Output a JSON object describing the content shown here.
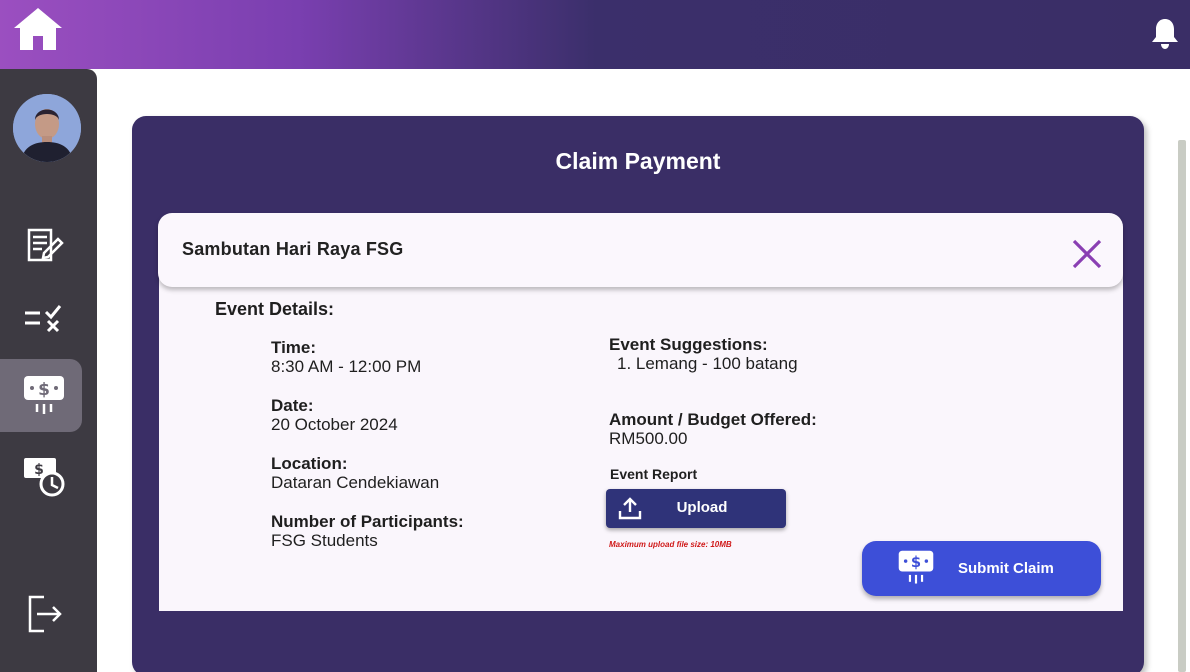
{
  "header": {
    "home_icon": "home-icon",
    "notification_icon": "bell-icon"
  },
  "sidebar": {
    "avatar": "user-avatar",
    "items": [
      {
        "icon": "document-edit-icon",
        "active": false
      },
      {
        "icon": "checklist-icon",
        "active": false
      },
      {
        "icon": "claim-payment-icon",
        "active": true
      },
      {
        "icon": "payment-history-icon",
        "active": false
      },
      {
        "icon": "logout-icon",
        "active": false
      }
    ]
  },
  "panel": {
    "title": "Claim Payment"
  },
  "card": {
    "title": "Sambutan Hari Raya FSG",
    "section_title": "Event Details:",
    "time_label": "Time:",
    "time_value": "8:30 AM - 12:00 PM",
    "date_label": "Date:",
    "date_value": "20 October 2024",
    "location_label": "Location:",
    "location_value": "Dataran Cendekiawan",
    "participants_label": "Number of Participants:",
    "participants_value": "FSG Students",
    "suggestions_label": "Event Suggestions:",
    "suggestions_items": [
      "1.  Lemang - 100 batang"
    ],
    "budget_label": "Amount / Budget Offered:",
    "budget_value": "RM500.00",
    "report_label": "Event Report",
    "upload_label": "Upload",
    "upload_note": "Maximum upload file size: 10MB",
    "submit_label": "Submit Claim"
  },
  "colors": {
    "topbar_gradient_start": "#9b4fc0",
    "topbar_end": "#3a2e66",
    "sidebar": "#3d3a42",
    "panel": "#3a2e66",
    "upload_button": "#2f3379",
    "submit_button": "#3d4fd8",
    "close_icon": "#8a3fb3",
    "warning_text": "#d01a1a"
  }
}
